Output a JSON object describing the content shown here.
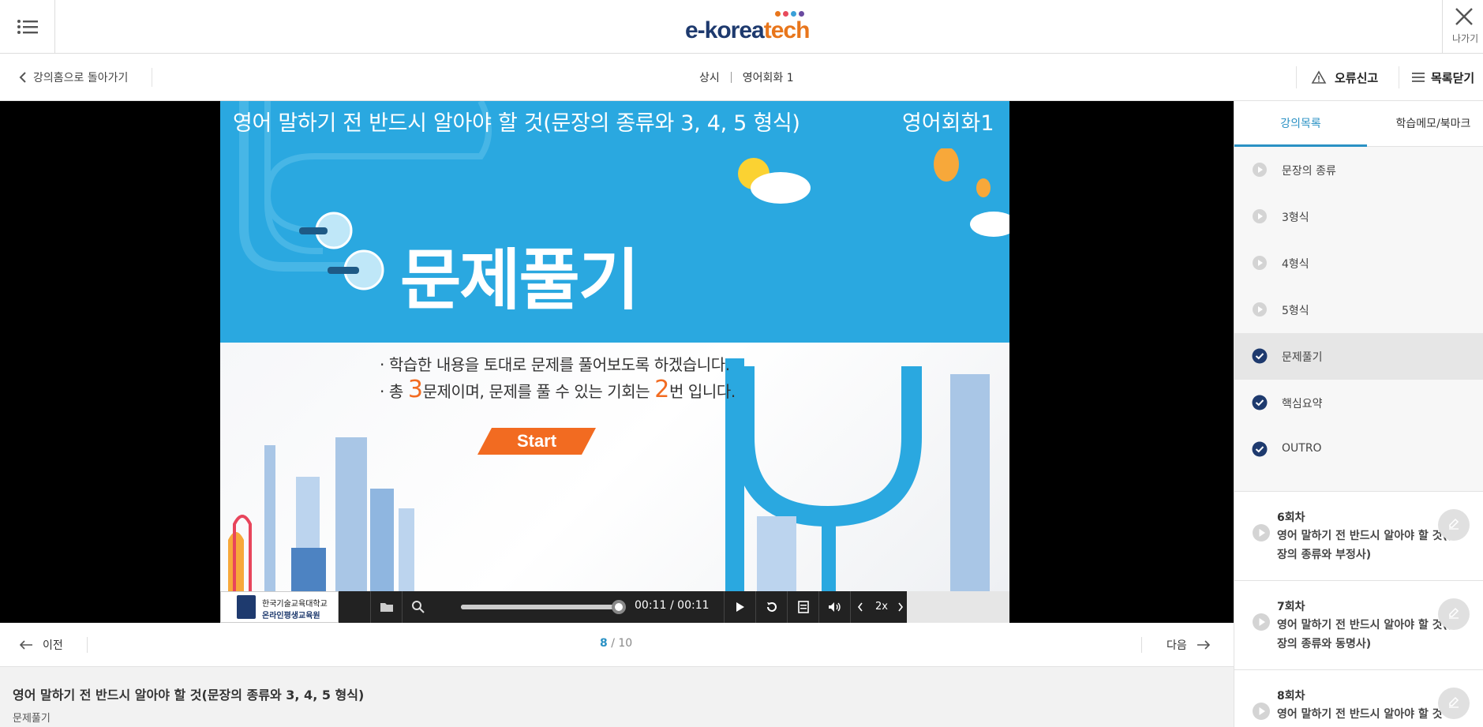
{
  "header": {
    "logo_text_main": "e-korea",
    "logo_text_accent": "tech",
    "logo_dot_colors": [
      "#e8761c",
      "#e84b5c",
      "#3aa0d8",
      "#6a4aa0"
    ],
    "exit_label": "나가기"
  },
  "subnav": {
    "back_label": "강의홈으로 돌아가기",
    "crumb_level": "상시",
    "crumb_course": "영어회화 1",
    "report_label": "오류신고",
    "close_list_label": "목록닫기"
  },
  "slide": {
    "title": "영어 말하기 전 반드시 알아야 할 것(문장의 종류와 3, 4, 5 형식)",
    "course": "영어회화1",
    "heading": "문제풀기",
    "bullet1": "· 학습한 내용을 토대로 문제를 풀어보도록 하겠습니다.",
    "bullet2_pre": "· 총 ",
    "bullet2_num1": "3",
    "bullet2_mid": "문제이며, 문제를 풀 수 있는 기회는 ",
    "bullet2_num2": "2",
    "bullet2_post": "번 입니다.",
    "start_label": "Start",
    "colors": {
      "sky": "#2aa8e0",
      "accent": "#f26b21"
    }
  },
  "player": {
    "org_line1": "한국기술교육대학교",
    "org_line2": "온라인평생교육원",
    "current_time": "00:11",
    "total_time": "/ 00:11",
    "progress": 1.0,
    "speed": "2x"
  },
  "pager": {
    "prev_label": "이전",
    "current": "8",
    "total": " / 10",
    "next_label": "다음"
  },
  "lesson": {
    "title": "영어 말하기 전 반드시 알아야 할 것(문장의 종류와 3, 4, 5 형식)",
    "subtitle": "문제풀기"
  },
  "sidebar": {
    "tabs": [
      {
        "label": "강의목록",
        "active": true
      },
      {
        "label": "학습메모/북마크",
        "active": false
      }
    ],
    "chapters": [
      {
        "label": "문장의 종류",
        "status": "play"
      },
      {
        "label": "3형식",
        "status": "play"
      },
      {
        "label": "4형식",
        "status": "play"
      },
      {
        "label": "5형식",
        "status": "play"
      },
      {
        "label": "문제풀기",
        "status": "done",
        "current": true
      },
      {
        "label": "핵심요약",
        "status": "done"
      },
      {
        "label": "OUTRO",
        "status": "done"
      }
    ],
    "sessions": [
      {
        "num": "6회차",
        "title": "영어 말하기 전 반드시 알아야 할 것(문장의 종류와 부정사)"
      },
      {
        "num": "7회차",
        "title": "영어 말하기 전 반드시 알아야 할 것(문장의 종류와 동명사)"
      },
      {
        "num": "8회차",
        "title": "영어 말하기 전 반드시 알아야 할 것"
      }
    ]
  }
}
